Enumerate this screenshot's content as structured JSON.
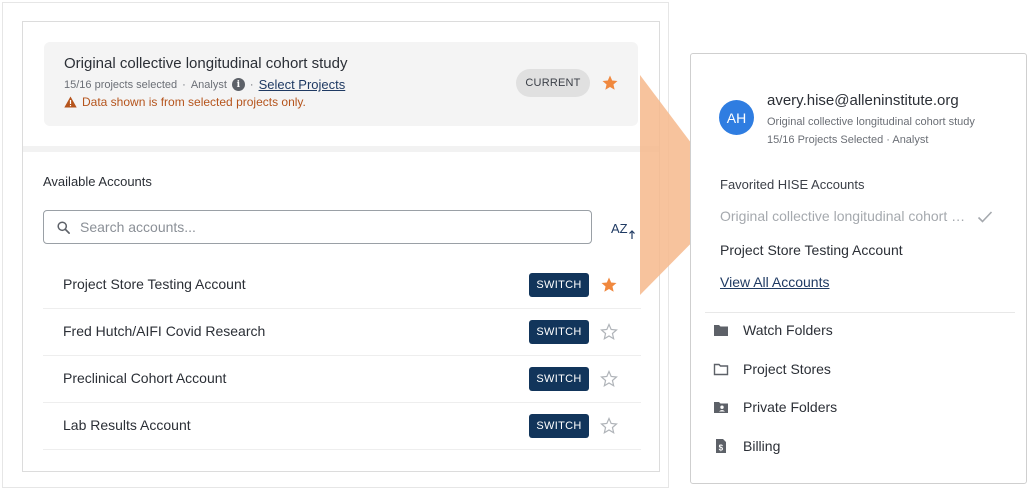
{
  "current": {
    "title": "Original collective longitudinal cohort study",
    "selected": "15/16 projects selected",
    "separator": "·",
    "role": "Analyst",
    "select_link": "Select Projects",
    "warning": "Data shown is from selected projects only.",
    "badge": "CURRENT"
  },
  "available": {
    "label": "Available Accounts",
    "search_placeholder": "Search accounts...",
    "sort_label": "AZ",
    "switch_label": "SWITCH",
    "accounts": [
      {
        "name": "Project Store Testing Account",
        "favorited": true
      },
      {
        "name": "Fred Hutch/AIFI Covid Research",
        "favorited": false
      },
      {
        "name": "Preclinical Cohort Account",
        "favorited": false
      },
      {
        "name": "Lab Results Account",
        "favorited": false
      }
    ]
  },
  "user": {
    "initials": "AH",
    "email": "avery.hise@alleninstitute.org",
    "study": "Original collective longitudinal cohort study",
    "meta": "15/16 Projects Selected · Analyst"
  },
  "favorites": {
    "label": "Favorited HISE Accounts",
    "items": [
      "Original collective longitudinal cohort study",
      "Project Store Testing Account"
    ],
    "view_all": "View All Accounts"
  },
  "menu": [
    {
      "label": "Watch Folders",
      "icon": "folder-filled-icon"
    },
    {
      "label": "Project Stores",
      "icon": "folder-outline-icon"
    },
    {
      "label": "Private Folders",
      "icon": "folder-user-icon"
    },
    {
      "label": "Billing",
      "icon": "billing-icon"
    }
  ],
  "colors": {
    "accent_orange": "#f0883e",
    "switch_navy": "#12355b",
    "avatar_blue": "#2f7de1",
    "warning": "#b5541c"
  }
}
